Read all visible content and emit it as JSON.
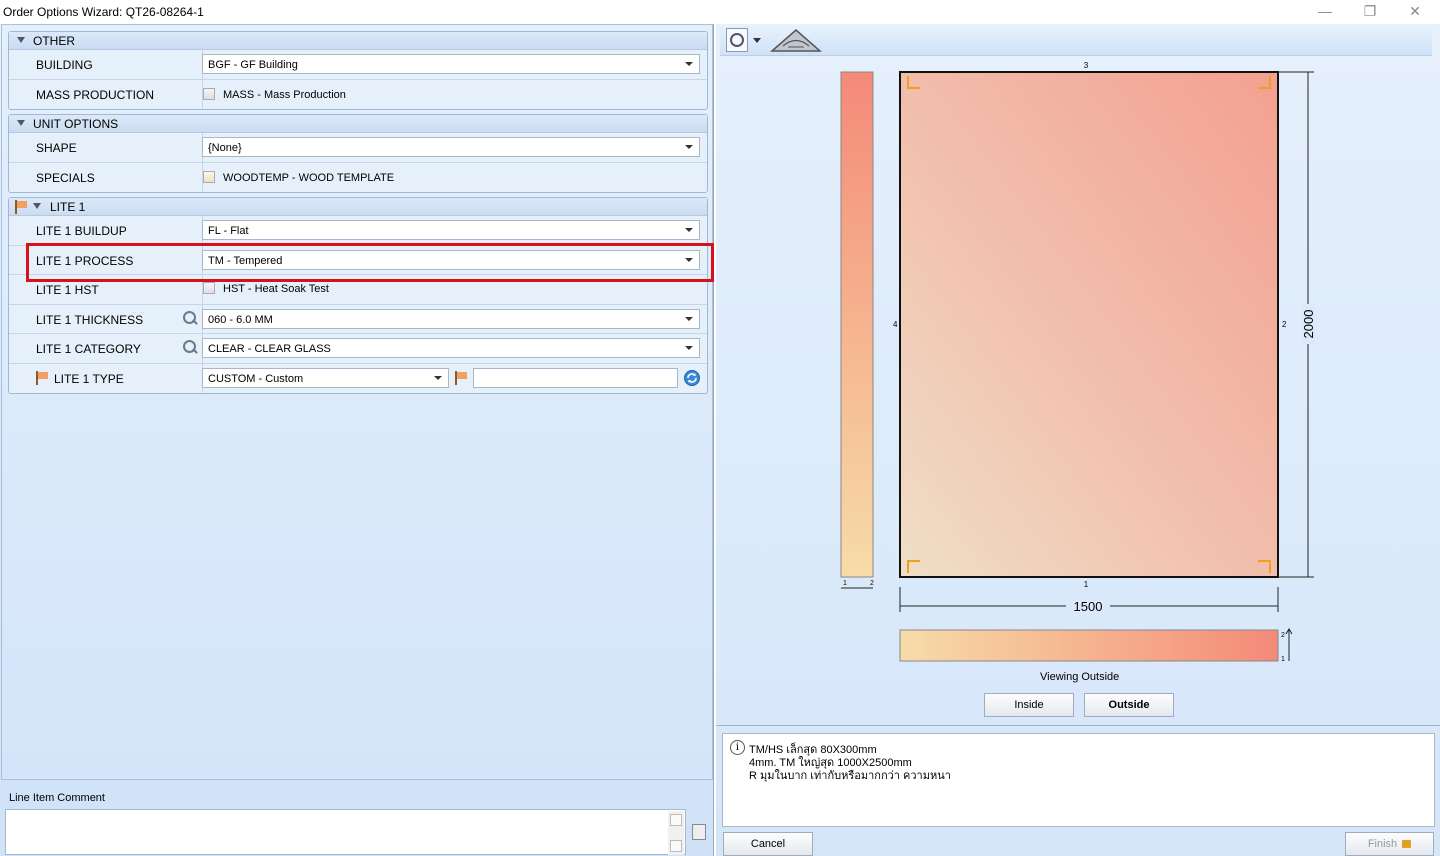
{
  "window": {
    "title": "Order Options Wizard: QT26-08264-1",
    "minimize": "—",
    "restore": "❐",
    "close": "✕"
  },
  "sections": {
    "other": {
      "title": "OTHER",
      "building_label": "BUILDING",
      "building_value": "BGF - GF Building",
      "mass_label": "MASS PRODUCTION",
      "mass_checkbox_label": "MASS - Mass Production"
    },
    "unit_options": {
      "title": "UNIT OPTIONS",
      "shape_label": "SHAPE",
      "shape_value": "{None}",
      "specials_label": "SPECIALS",
      "specials_checkbox_label": "WOODTEMP - WOOD TEMPLATE"
    },
    "lite1": {
      "title": "LITE 1",
      "buildup_label": "LITE 1 BUILDUP",
      "buildup_value": "FL - Flat",
      "process_label": "LITE 1 PROCESS",
      "process_value": "TM - Tempered",
      "hst_label": "LITE 1 HST",
      "hst_checkbox_label": "HST - Heat Soak Test",
      "thickness_label": "LITE 1 THICKNESS",
      "thickness_value": "060 - 6.0 MM",
      "category_label": "LITE 1 CATEGORY",
      "category_value": "CLEAR - CLEAR GLASS",
      "type_label": "LITE 1 TYPE",
      "type_value": "CUSTOM - Custom",
      "type_text_value": ""
    }
  },
  "comment": {
    "label": "Line Item Comment",
    "value": ""
  },
  "preview": {
    "edge_top": "3",
    "edge_right": "2",
    "edge_bottom": "1",
    "edge_left": "4",
    "width_dim": "1500",
    "height_dim": "2000",
    "side_small_1": "1",
    "side_small_2": "2",
    "bottom_small_2": "2",
    "bottom_small_1": "1",
    "viewing_label": "Viewing Outside",
    "inside_button": "Inside",
    "outside_button": "Outside",
    "colors": {
      "warm_light": "#f7dca8",
      "warm_dark": "#f48a78",
      "corner_marker": "#f0a020"
    }
  },
  "info": {
    "lines": [
      "TM/HS เล็กสุด 80X300mm",
      "4mm. TM ใหญ่สุด 1000X2500mm",
      "R มุมในบาก เท่ากับหรือมากกว่า ความหนา"
    ]
  },
  "footer": {
    "cancel": "Cancel",
    "finish": "Finish"
  }
}
